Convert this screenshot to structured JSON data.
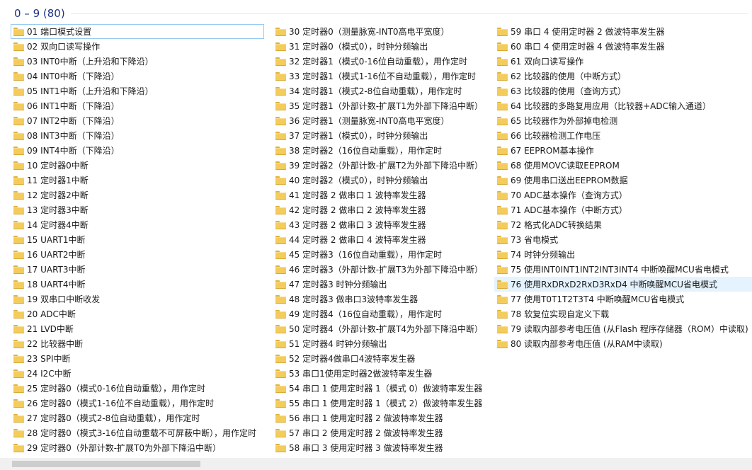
{
  "group": {
    "header": "0 – 9 (80)"
  },
  "columns": [
    {
      "items": [
        "01  端口模式设置",
        "02  双向口读写操作",
        "03  INT0中断（上升沿和下降沿）",
        "04  INT0中断（下降沿）",
        "05  INT1中断（上升沿和下降沿）",
        "06  INT1中断（下降沿）",
        "07  INT2中断（下降沿）",
        "08  INT3中断（下降沿）",
        "09  INT4中断（下降沿）",
        "10  定时器0中断",
        "11  定时器1中断",
        "12  定时器2中断",
        "13  定时器3中断",
        "14  定时器4中断",
        "15  UART1中断",
        "16  UART2中断",
        "17  UART3中断",
        "18  UART4中断",
        "19 双串口中断收发",
        "20  ADC中断",
        "21  LVD中断",
        "22  比较器中断",
        "23  SPI中断",
        "24  I2C中断",
        "25  定时器0（模式0-16位自动重载），用作定时",
        "26  定时器0（模式1-16位不自动重载），用作定时",
        "27  定时器0（模式2-8位自动重载），用作定时",
        "28  定时器0（模式3-16位自动重载不可屏蔽中断），用作定时",
        "29  定时器0（外部计数-扩展T0为外部下降沿中断）"
      ]
    },
    {
      "items": [
        "30  定时器0（测量脉宽-INT0高电平宽度）",
        "31  定时器0（模式0），时钟分频输出",
        "32  定时器1（模式0-16位自动重载），用作定时",
        "33  定时器1（模式1-16位不自动重载），用作定时",
        "34  定时器1（模式2-8位自动重载），用作定时",
        "35  定时器1（外部计数-扩展T1为外部下降沿中断）",
        "36  定时器1（测量脉宽-INT0高电平宽度）",
        "37  定时器1（模式0），时钟分频输出",
        "38  定时器2（16位自动重载），用作定时",
        "39  定时器2（外部计数-扩展T2为外部下降沿中断）",
        "40  定时器2（模式0），时钟分频输出",
        "41 定时器 2 做串口 1 波特率发生器",
        "42 定时器 2 做串口 2 波特率发生器",
        "43 定时器 2 做串口 3 波特率发生器",
        "44 定时器 2 做串口 4 波特率发生器",
        "45  定时器3（16位自动重载），用作定时",
        "46  定时器3（外部计数-扩展T3为外部下降沿中断）",
        "47  定时器3 时钟分频输出",
        "48  定时器3 做串口3波特率发生器",
        "49  定时器4（16位自动重载），用作定时",
        "50  定时器4（外部计数-扩展T4为外部下降沿中断）",
        "51  定时器4 时钟分频输出",
        "52  定时器4做串口4波特率发生器",
        "53 串口1使用定时器2做波特率发生器",
        "54 串口 1 使用定时器 1（模式 0）做波特率发生器",
        "55 串口 1 使用定时器 1（模式 2）做波特率发生器",
        "56 串口 1 使用定时器 2 做波特率发生器",
        "57 串口 2 使用定时器 2 做波特率发生器",
        "58 串口 3 使用定时器 3 做波特率发生器"
      ]
    },
    {
      "items": [
        "59 串口 4 使用定时器 2 做波特率发生器",
        "60 串口 4 使用定时器 4 做波特率发生器",
        "61 双向口读写操作",
        "62  比较器的使用（中断方式）",
        "63  比较器的使用（查询方式）",
        "64 比较器的多路复用应用（比较器+ADC输入通道）",
        "65 比较器作为外部掉电检测",
        "66  比较器检测工作电压",
        "67  EEPROM基本操作",
        "68  使用MOVC读取EEPROM",
        "69  使用串口送出EEPROM数据",
        "70  ADC基本操作（查询方式）",
        "71  ADC基本操作（中断方式）",
        "72  格式化ADC转换结果",
        "73 省电模式",
        "74 时钟分频输出",
        "75 使用INT0INT1INT2INT3INT4 中断唤醒MCU省电模式",
        "76 使用RxDRxD2RxD3RxD4 中断唤醒MCU省电模式",
        "77 使用T0T1T2T3T4 中断唤醒MCU省电模式",
        "78 软复位实现自定义下载",
        "79 读取内部参考电压值 (从Flash 程序存储器（ROM）中读取)",
        "80 读取内部参考电压值 (从RAM中读取)"
      ]
    }
  ],
  "state": {
    "focused_item": "01  端口模式设置",
    "hovered_item": "76 使用RxDRxD2RxD3RxD4 中断唤醒MCU省电模式"
  },
  "colors": {
    "header_text": "#1e3287",
    "focus_border": "#99c9ef",
    "hover_bg": "#e5f3ff",
    "folder": "#f3cc5c"
  },
  "icons": {
    "item_icon": "folder-icon"
  }
}
